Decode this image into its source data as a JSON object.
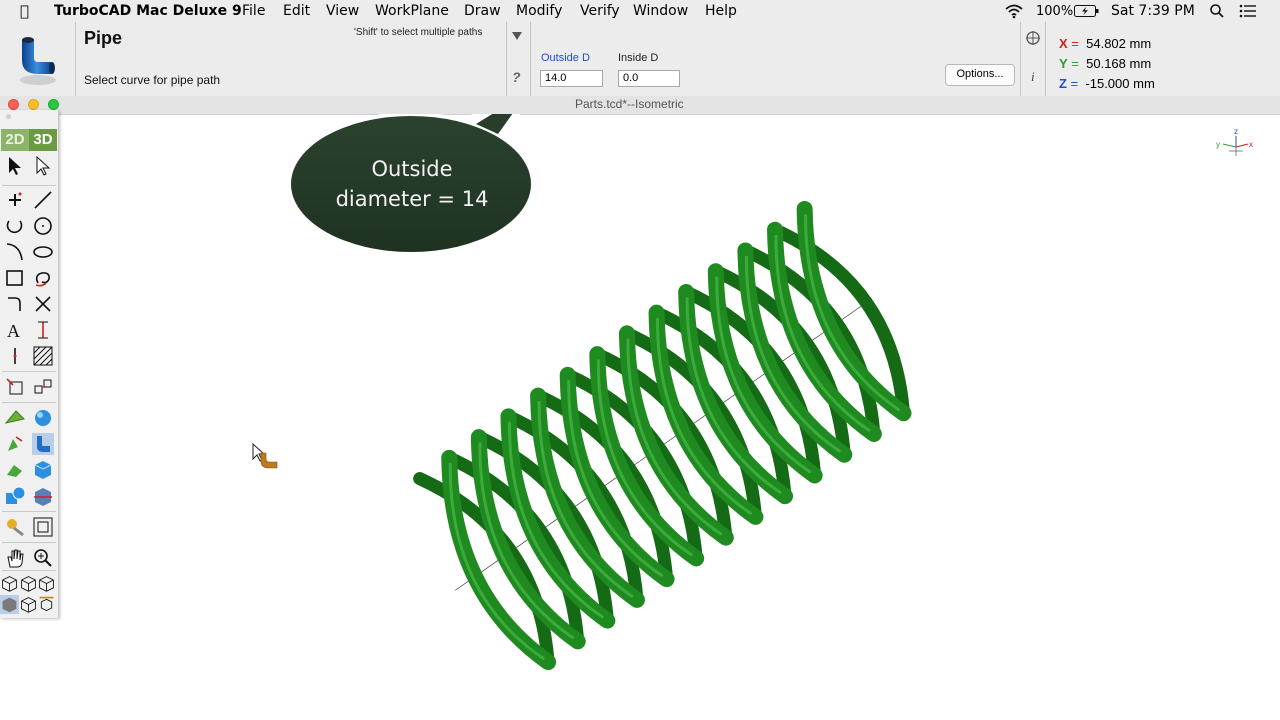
{
  "menubar": {
    "app_name": "TurboCAD Mac Deluxe 9",
    "items": [
      "File",
      "Edit",
      "View",
      "WorkPlane",
      "Draw",
      "Modify",
      "Verify",
      "Window",
      "Help"
    ],
    "status": {
      "battery": "100%",
      "clock": "Sat 7:39 PM"
    }
  },
  "propbar": {
    "tool_title": "Pipe",
    "hint": "'Shift' to select multiple paths",
    "prompt": "Select curve for pipe path",
    "fields": [
      {
        "label": "Outside D",
        "value": "14.0",
        "label_color": "#1f4fcf"
      },
      {
        "label": "Inside D",
        "value": "0.0",
        "label_color": "#222222"
      }
    ],
    "options_label": "Options...",
    "help_glyph": "?",
    "info_glyph": "i",
    "coords": [
      {
        "axis": "X",
        "eq": "=",
        "value": "54.802 mm",
        "color": "#d21f1f"
      },
      {
        "axis": "Y",
        "eq": "=",
        "value": "50.168 mm",
        "color": "#2f9a2f"
      },
      {
        "axis": "Z",
        "eq": "=",
        "value": "-15.000 mm",
        "color": "#1f4fcf"
      }
    ]
  },
  "window": {
    "title": "Parts.tcd*--Isometric"
  },
  "toolbox": {
    "tab_2d": "2D",
    "tab_3d": "3D"
  },
  "callout": {
    "line1": "Outside",
    "line2": "diameter = 14"
  },
  "axis_labels": {
    "x": "x",
    "y": "y",
    "z": "z"
  },
  "colors": {
    "spring_green": "#1f8a1f",
    "callout_fill": "#263b29",
    "axis_x": "#d21f1f",
    "axis_y": "#2f9a2f",
    "axis_z": "#1f4fcf"
  }
}
